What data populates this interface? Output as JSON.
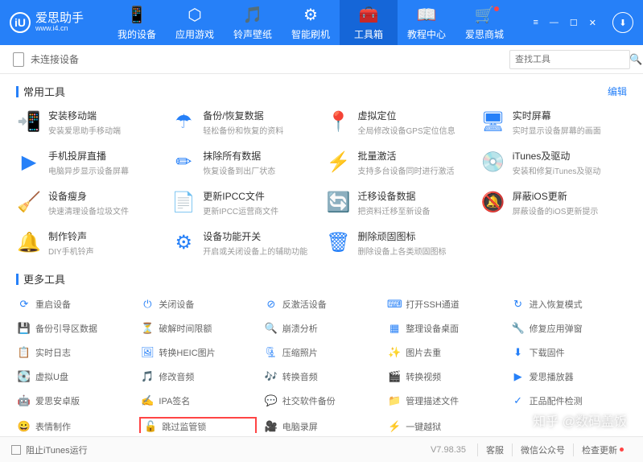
{
  "brand": {
    "name": "爱思助手",
    "url": "www.i4.cn",
    "badge": "iU"
  },
  "nav": [
    {
      "icon": "📱",
      "label": "我的设备"
    },
    {
      "icon": "⬡",
      "label": "应用游戏"
    },
    {
      "icon": "🎵",
      "label": "铃声壁纸"
    },
    {
      "icon": "⚙",
      "label": "智能刷机"
    },
    {
      "icon": "🧰",
      "label": "工具箱"
    },
    {
      "icon": "📖",
      "label": "教程中心"
    },
    {
      "icon": "🛒",
      "label": "爱思商城"
    }
  ],
  "device": {
    "status": "未连接设备"
  },
  "search": {
    "placeholder": "查找工具"
  },
  "sec1": {
    "title": "常用工具",
    "edit": "编辑"
  },
  "common": [
    {
      "icon": "📲",
      "title": "安装移动端",
      "sub": "安装爱思助手移动端"
    },
    {
      "icon": "☂",
      "title": "备份/恢复数据",
      "sub": "轻松备份和恢复的资料"
    },
    {
      "icon": "📍",
      "title": "虚拟定位",
      "sub": "全局修改设备GPS定位信息"
    },
    {
      "icon": "🖥",
      "title": "实时屏幕",
      "sub": "实时显示设备屏幕的画面"
    },
    {
      "icon": "▶",
      "title": "手机投屏直播",
      "sub": "电脑异步显示设备屏幕"
    },
    {
      "icon": "✏",
      "title": "抹除所有数据",
      "sub": "恢复设备到出厂状态"
    },
    {
      "icon": "⚡",
      "title": "批量激活",
      "sub": "支持多台设备同时进行激活"
    },
    {
      "icon": "💿",
      "title": "iTunes及驱动",
      "sub": "安装和修复iTunes及驱动"
    },
    {
      "icon": "🧹",
      "title": "设备瘦身",
      "sub": "快速清理设备垃圾文件"
    },
    {
      "icon": "📄",
      "title": "更新IPCC文件",
      "sub": "更新IPCC运营商文件"
    },
    {
      "icon": "🔄",
      "title": "迁移设备数据",
      "sub": "把资料迁移至新设备"
    },
    {
      "icon": "🔕",
      "title": "屏蔽iOS更新",
      "sub": "屏蔽设备的iOS更新提示"
    },
    {
      "icon": "🔔",
      "title": "制作铃声",
      "sub": "DIY手机铃声"
    },
    {
      "icon": "⚙",
      "title": "设备功能开关",
      "sub": "开启或关闭设备上的辅助功能"
    },
    {
      "icon": "🗑",
      "title": "删除顽固图标",
      "sub": "删除设备上各类顽固图标"
    }
  ],
  "sec2": {
    "title": "更多工具"
  },
  "more": [
    {
      "icon": "⟳",
      "label": "重启设备"
    },
    {
      "icon": "⏻",
      "label": "关闭设备"
    },
    {
      "icon": "⊘",
      "label": "反激活设备"
    },
    {
      "icon": "⌨",
      "label": "打开SSH通道"
    },
    {
      "icon": "↻",
      "label": "进入恢复模式"
    },
    {
      "icon": "💾",
      "label": "备份引导区数据"
    },
    {
      "icon": "⏳",
      "label": "破解时间限额"
    },
    {
      "icon": "🔍",
      "label": "崩溃分析"
    },
    {
      "icon": "▦",
      "label": "整理设备桌面"
    },
    {
      "icon": "🔧",
      "label": "修复应用弹窗"
    },
    {
      "icon": "📋",
      "label": "实时日志"
    },
    {
      "icon": "🖼",
      "label": "转换HEIC图片"
    },
    {
      "icon": "🗜",
      "label": "压缩照片"
    },
    {
      "icon": "✨",
      "label": "图片去重"
    },
    {
      "icon": "⬇",
      "label": "下载固件"
    },
    {
      "icon": "💽",
      "label": "虚拟U盘"
    },
    {
      "icon": "🎵",
      "label": "修改音频"
    },
    {
      "icon": "🎶",
      "label": "转换音频"
    },
    {
      "icon": "🎬",
      "label": "转换视频"
    },
    {
      "icon": "▶",
      "label": "爱思播放器"
    },
    {
      "icon": "🤖",
      "label": "爱思安卓版"
    },
    {
      "icon": "✍",
      "label": "IPA签名"
    },
    {
      "icon": "💬",
      "label": "社交软件备份"
    },
    {
      "icon": "📁",
      "label": "管理描述文件"
    },
    {
      "icon": "✓",
      "label": "正品配件检测"
    },
    {
      "icon": "😀",
      "label": "表情制作"
    },
    {
      "icon": "🔓",
      "label": "跳过监管锁"
    },
    {
      "icon": "🎥",
      "label": "电脑录屏"
    },
    {
      "icon": "⚡",
      "label": "一键越狱"
    }
  ],
  "footer": {
    "block": "阻止iTunes运行",
    "version": "V7.98.35",
    "b1": "客服",
    "b2": "微信公众号",
    "b3": "检查更新"
  },
  "watermark": "知乎 @数码盖饭"
}
